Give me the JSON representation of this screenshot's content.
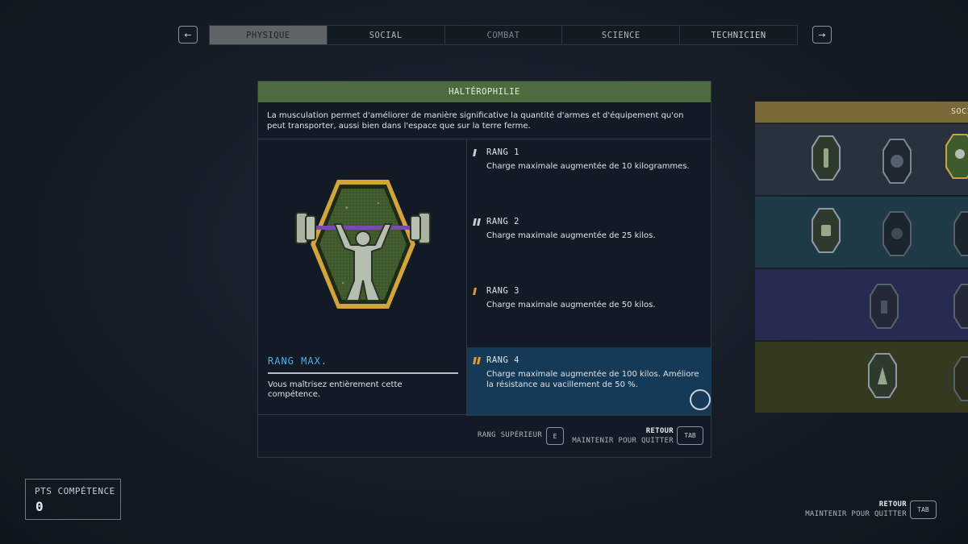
{
  "nav": {
    "prev_icon": "←",
    "next_icon": "→",
    "tabs": [
      {
        "label": "PHYSIQUE",
        "active": true
      },
      {
        "label": "SOCIAL",
        "active": false
      },
      {
        "label": "COMBAT",
        "active": false
      },
      {
        "label": "SCIENCE",
        "active": false
      },
      {
        "label": "TECHNICIEN",
        "active": false
      }
    ]
  },
  "skill": {
    "title": "HALTÉROPHILIE",
    "description": "La musculation permet d'améliorer de manière significative la quantité d'armes et d'équipement qu'on peut transporter, aussi bien dans l'espace que sur la terre ferme.",
    "badge_icon": "weightlifter-badge-icon",
    "rank_max_title": "RANG MAX.",
    "rank_max_text": "Vous maîtrisez entièrement cette compétence.",
    "ranks": [
      {
        "label": "RANG 1",
        "desc": "Charge maximale augmentée de 10 kilogrammes."
      },
      {
        "label": "RANG 2",
        "desc": "Charge maximale augmentée de 25 kilos."
      },
      {
        "label": "RANG 3",
        "desc": "Charge maximale augmentée de 50 kilos."
      },
      {
        "label": "RANG 4",
        "desc": "Charge maximale augmentée de 100 kilos. Améliore la résistance au vacillement de 50 %."
      }
    ]
  },
  "footer": {
    "upgrade_label": "RANG SUPÉRIEUR",
    "upgrade_key": "E",
    "back_label": "RETOUR",
    "hold_label": "MAINTENIR POUR QUITTER",
    "back_key": "TAB"
  },
  "tree": {
    "header_label": "SOCI"
  },
  "skill_points": {
    "label": "PTS COMPÉTENCE",
    "value": "0"
  },
  "bottom": {
    "back_label": "RETOUR",
    "hold_label": "MAINTENIR POUR QUITTER",
    "back_key": "TAB"
  },
  "colors": {
    "header_green": "#4c6b3e",
    "rank_max_blue": "#4fb0e8",
    "active_rank_bg": "#153a58",
    "pip_gold": "#e59a2a"
  }
}
